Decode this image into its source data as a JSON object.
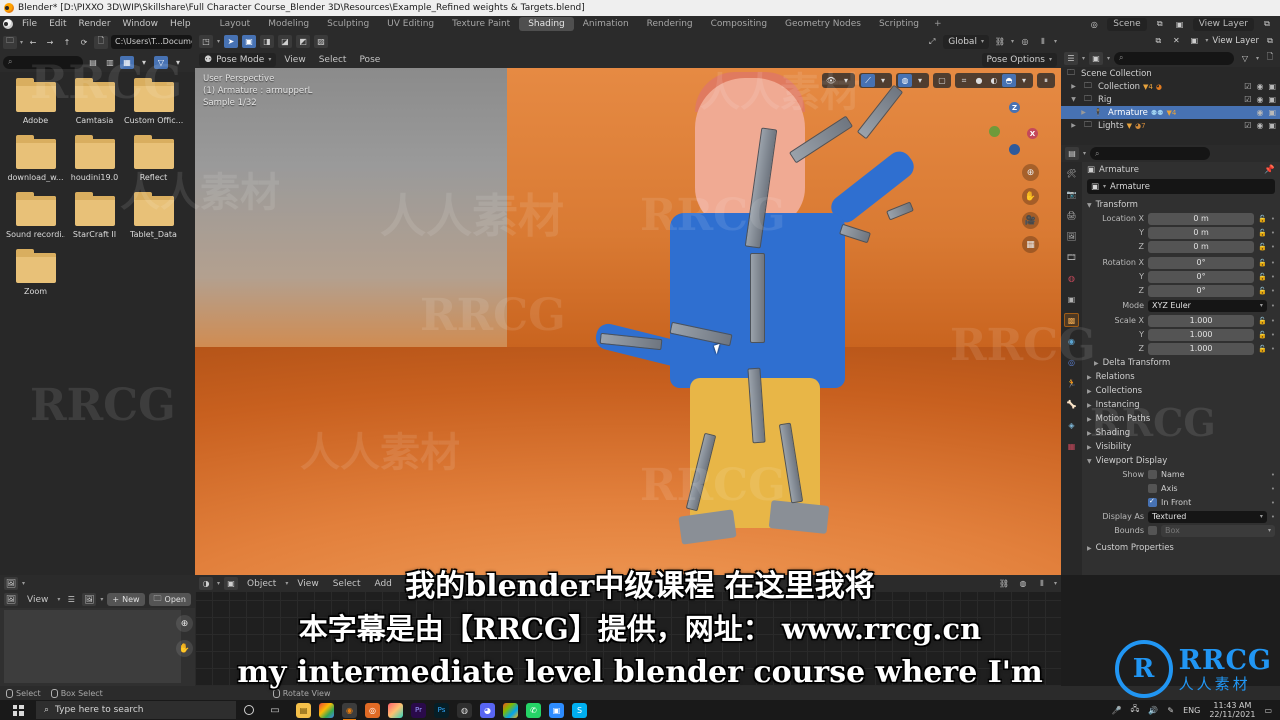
{
  "window": {
    "title": "Blender* [D:\\PIXXO 3D\\WIP\\Skillshare\\Full Character Course_Blender 3D\\Resources\\Example_Refined weights  & Targets.blend]",
    "app_icon": "blender-logo-icon"
  },
  "topbar": {
    "menus": [
      "File",
      "Edit",
      "Render",
      "Window",
      "Help"
    ],
    "workspace_tabs": [
      {
        "label": "Layout",
        "active": false
      },
      {
        "label": "Modeling",
        "active": false
      },
      {
        "label": "Sculpting",
        "active": false
      },
      {
        "label": "UV Editing",
        "active": false
      },
      {
        "label": "Texture Paint",
        "active": false
      },
      {
        "label": "Shading",
        "active": true
      },
      {
        "label": "Animation",
        "active": false
      },
      {
        "label": "Rendering",
        "active": false
      },
      {
        "label": "Compositing",
        "active": false
      },
      {
        "label": "Geometry Nodes",
        "active": false
      },
      {
        "label": "Scripting",
        "active": false
      },
      {
        "label": "+",
        "active": false
      }
    ],
    "scene_label": "Scene",
    "view_layer_label": "View Layer"
  },
  "file_browser": {
    "path": "C:\\Users\\T...Documents\\",
    "search_placeholder": "",
    "nav_icons": [
      "back-arrow-icon",
      "forward-arrow-icon",
      "up-arrow-icon",
      "refresh-icon",
      "new-folder-icon"
    ],
    "display_mode": "thumbnail-grid",
    "items": [
      {
        "name": "Adobe"
      },
      {
        "name": "Camtasia"
      },
      {
        "name": "Custom Offic..."
      },
      {
        "name": "download_w..."
      },
      {
        "name": "houdini19.0"
      },
      {
        "name": "Reflect"
      },
      {
        "name": "Sound recordi..."
      },
      {
        "name": "StarCraft II"
      },
      {
        "name": "Tablet_Data"
      },
      {
        "name": "Zoom"
      }
    ]
  },
  "viewport": {
    "transform_orientation": "Global",
    "mode": "Pose Mode",
    "menus": [
      "View",
      "Select",
      "Pose"
    ],
    "pose_options_label": "Pose Options",
    "overlay": {
      "perspective": "User Perspective",
      "object": "(1) Armature : armupperL",
      "samples": "Sample 1/32"
    },
    "gizmo_axes": {
      "z": "Z",
      "x": "X"
    },
    "nav_icons": [
      "zoom-icon",
      "hand-icon",
      "camera-icon",
      "grid-icon"
    ]
  },
  "outliner": {
    "view_layer_label": "View Layer",
    "search_placeholder": "",
    "rows": [
      {
        "label": "Scene Collection",
        "depth": 0,
        "selected": false,
        "icon": "collection-icon"
      },
      {
        "label": "Collection",
        "depth": 1,
        "selected": false,
        "icon": "collection-icon"
      },
      {
        "label": "Rig",
        "depth": 1,
        "selected": false,
        "icon": "collection-icon"
      },
      {
        "label": "Armature",
        "depth": 2,
        "selected": true,
        "icon": "armature-icon"
      },
      {
        "label": "Lights",
        "depth": 1,
        "selected": false,
        "icon": "collection-icon"
      }
    ]
  },
  "properties": {
    "breadcrumb": "Armature",
    "object_name": "Armature",
    "sections": {
      "transform": {
        "title": "Transform",
        "location": {
          "label_x": "Location X",
          "label_y": "Y",
          "label_z": "Z",
          "x": "0 m",
          "y": "0 m",
          "z": "0 m"
        },
        "rotation": {
          "label_x": "Rotation X",
          "label_y": "Y",
          "label_z": "Z",
          "x": "0°",
          "y": "0°",
          "z": "0°"
        },
        "mode": {
          "label": "Mode",
          "value": "XYZ Euler"
        },
        "scale": {
          "label_x": "Scale X",
          "label_y": "Y",
          "label_z": "Z",
          "x": "1.000",
          "y": "1.000",
          "z": "1.000"
        }
      },
      "collapsed": [
        "Delta Transform",
        "Relations",
        "Collections",
        "Instancing",
        "Motion Paths",
        "Shading",
        "Visibility"
      ],
      "viewport_display": {
        "title": "Viewport Display",
        "show_label": "Show",
        "checkboxes": [
          {
            "label": "Name",
            "checked": false
          },
          {
            "label": "Axis",
            "checked": false
          },
          {
            "label": "In Front",
            "checked": true
          }
        ],
        "display_as": {
          "label": "Display As",
          "value": "Textured"
        },
        "bounds": {
          "label": "Bounds",
          "value": "Box",
          "checked": false
        }
      },
      "custom_properties": "Custom Properties"
    },
    "tab_icons": [
      "tool-icon",
      "render-icon",
      "output-icon",
      "view-layer-icon",
      "scene-icon",
      "world-icon",
      "collection-icon",
      "object-icon",
      "modifier-icon",
      "physics-icon",
      "constraint-icon",
      "data-icon",
      "material-icon",
      "texture-icon"
    ]
  },
  "image_editor": {
    "editor_type": "image-editor-icon",
    "view_menu": "View",
    "new_label": "New",
    "open_label": "Open",
    "side_icons": [
      "zoom-icon",
      "hand-icon"
    ]
  },
  "shader_editor": {
    "shader_type": "Object",
    "menus": [
      "View",
      "Select",
      "Add"
    ]
  },
  "status_bar": {
    "items": [
      {
        "icon": "mouse-left-icon",
        "label": "Select"
      },
      {
        "icon": "mouse-left-drag-icon",
        "label": "Box Select"
      },
      {
        "icon": "mouse-middle-icon",
        "label": "Rotate View"
      }
    ]
  },
  "taskbar": {
    "search_placeholder": "Type here to search",
    "start_icon": "windows-start-icon",
    "cortana_icon": "cortana-circle-icon",
    "taskview_icon": "task-view-icon",
    "apps": [
      {
        "name": "file-explorer-icon",
        "glyph": "🗁",
        "color": "#f5c04a",
        "active": false
      },
      {
        "name": "chrome-icon",
        "glyph": "●",
        "color": "#4caf50",
        "active": false
      },
      {
        "name": "blender-icon",
        "glyph": "●",
        "color": "#e87d0d",
        "active": true
      },
      {
        "name": "substance-icon",
        "glyph": "●",
        "color": "#e06a25",
        "active": false
      },
      {
        "name": "photos-icon",
        "glyph": "●",
        "color": "#e0457b",
        "active": false
      },
      {
        "name": "premiere-icon",
        "glyph": "Pr",
        "color": "#2a0a4a",
        "active": false
      },
      {
        "name": "photoshop-icon",
        "glyph": "Ps",
        "color": "#061e26",
        "active": false
      },
      {
        "name": "obs-icon",
        "glyph": "○",
        "color": "#2f2f2f",
        "active": false
      },
      {
        "name": "discord-icon",
        "glyph": "●",
        "color": "#5865f2",
        "active": false
      },
      {
        "name": "office-icon",
        "glyph": "●",
        "color": "#d83b01",
        "active": false
      },
      {
        "name": "whatsapp-icon",
        "glyph": "●",
        "color": "#25d366",
        "active": false
      },
      {
        "name": "zoom-app-icon",
        "glyph": "■",
        "color": "#2d8cff",
        "active": false
      },
      {
        "name": "skype-icon",
        "glyph": "S",
        "color": "#00aff0",
        "active": false
      }
    ],
    "tray": {
      "icons": [
        "mic-icon",
        "network-icon",
        "volume-icon",
        "pen-icon"
      ],
      "language": "ENG",
      "time": "11:43 AM",
      "date": "22/11/2021",
      "notification_icon": "notification-icon"
    }
  },
  "subtitles": {
    "line1": "我的blender中级课程 在这里我将",
    "line2": "本字幕是由【RRCG】提供，网址： www.rrcg.cn",
    "line3": "my intermediate level blender course where I'm"
  },
  "branding": {
    "logo_letter": "R",
    "name": "RRCG",
    "subtitle": "人人素材",
    "color": "#2196f3",
    "watermarks": [
      "RRCG",
      "人人素材"
    ]
  }
}
